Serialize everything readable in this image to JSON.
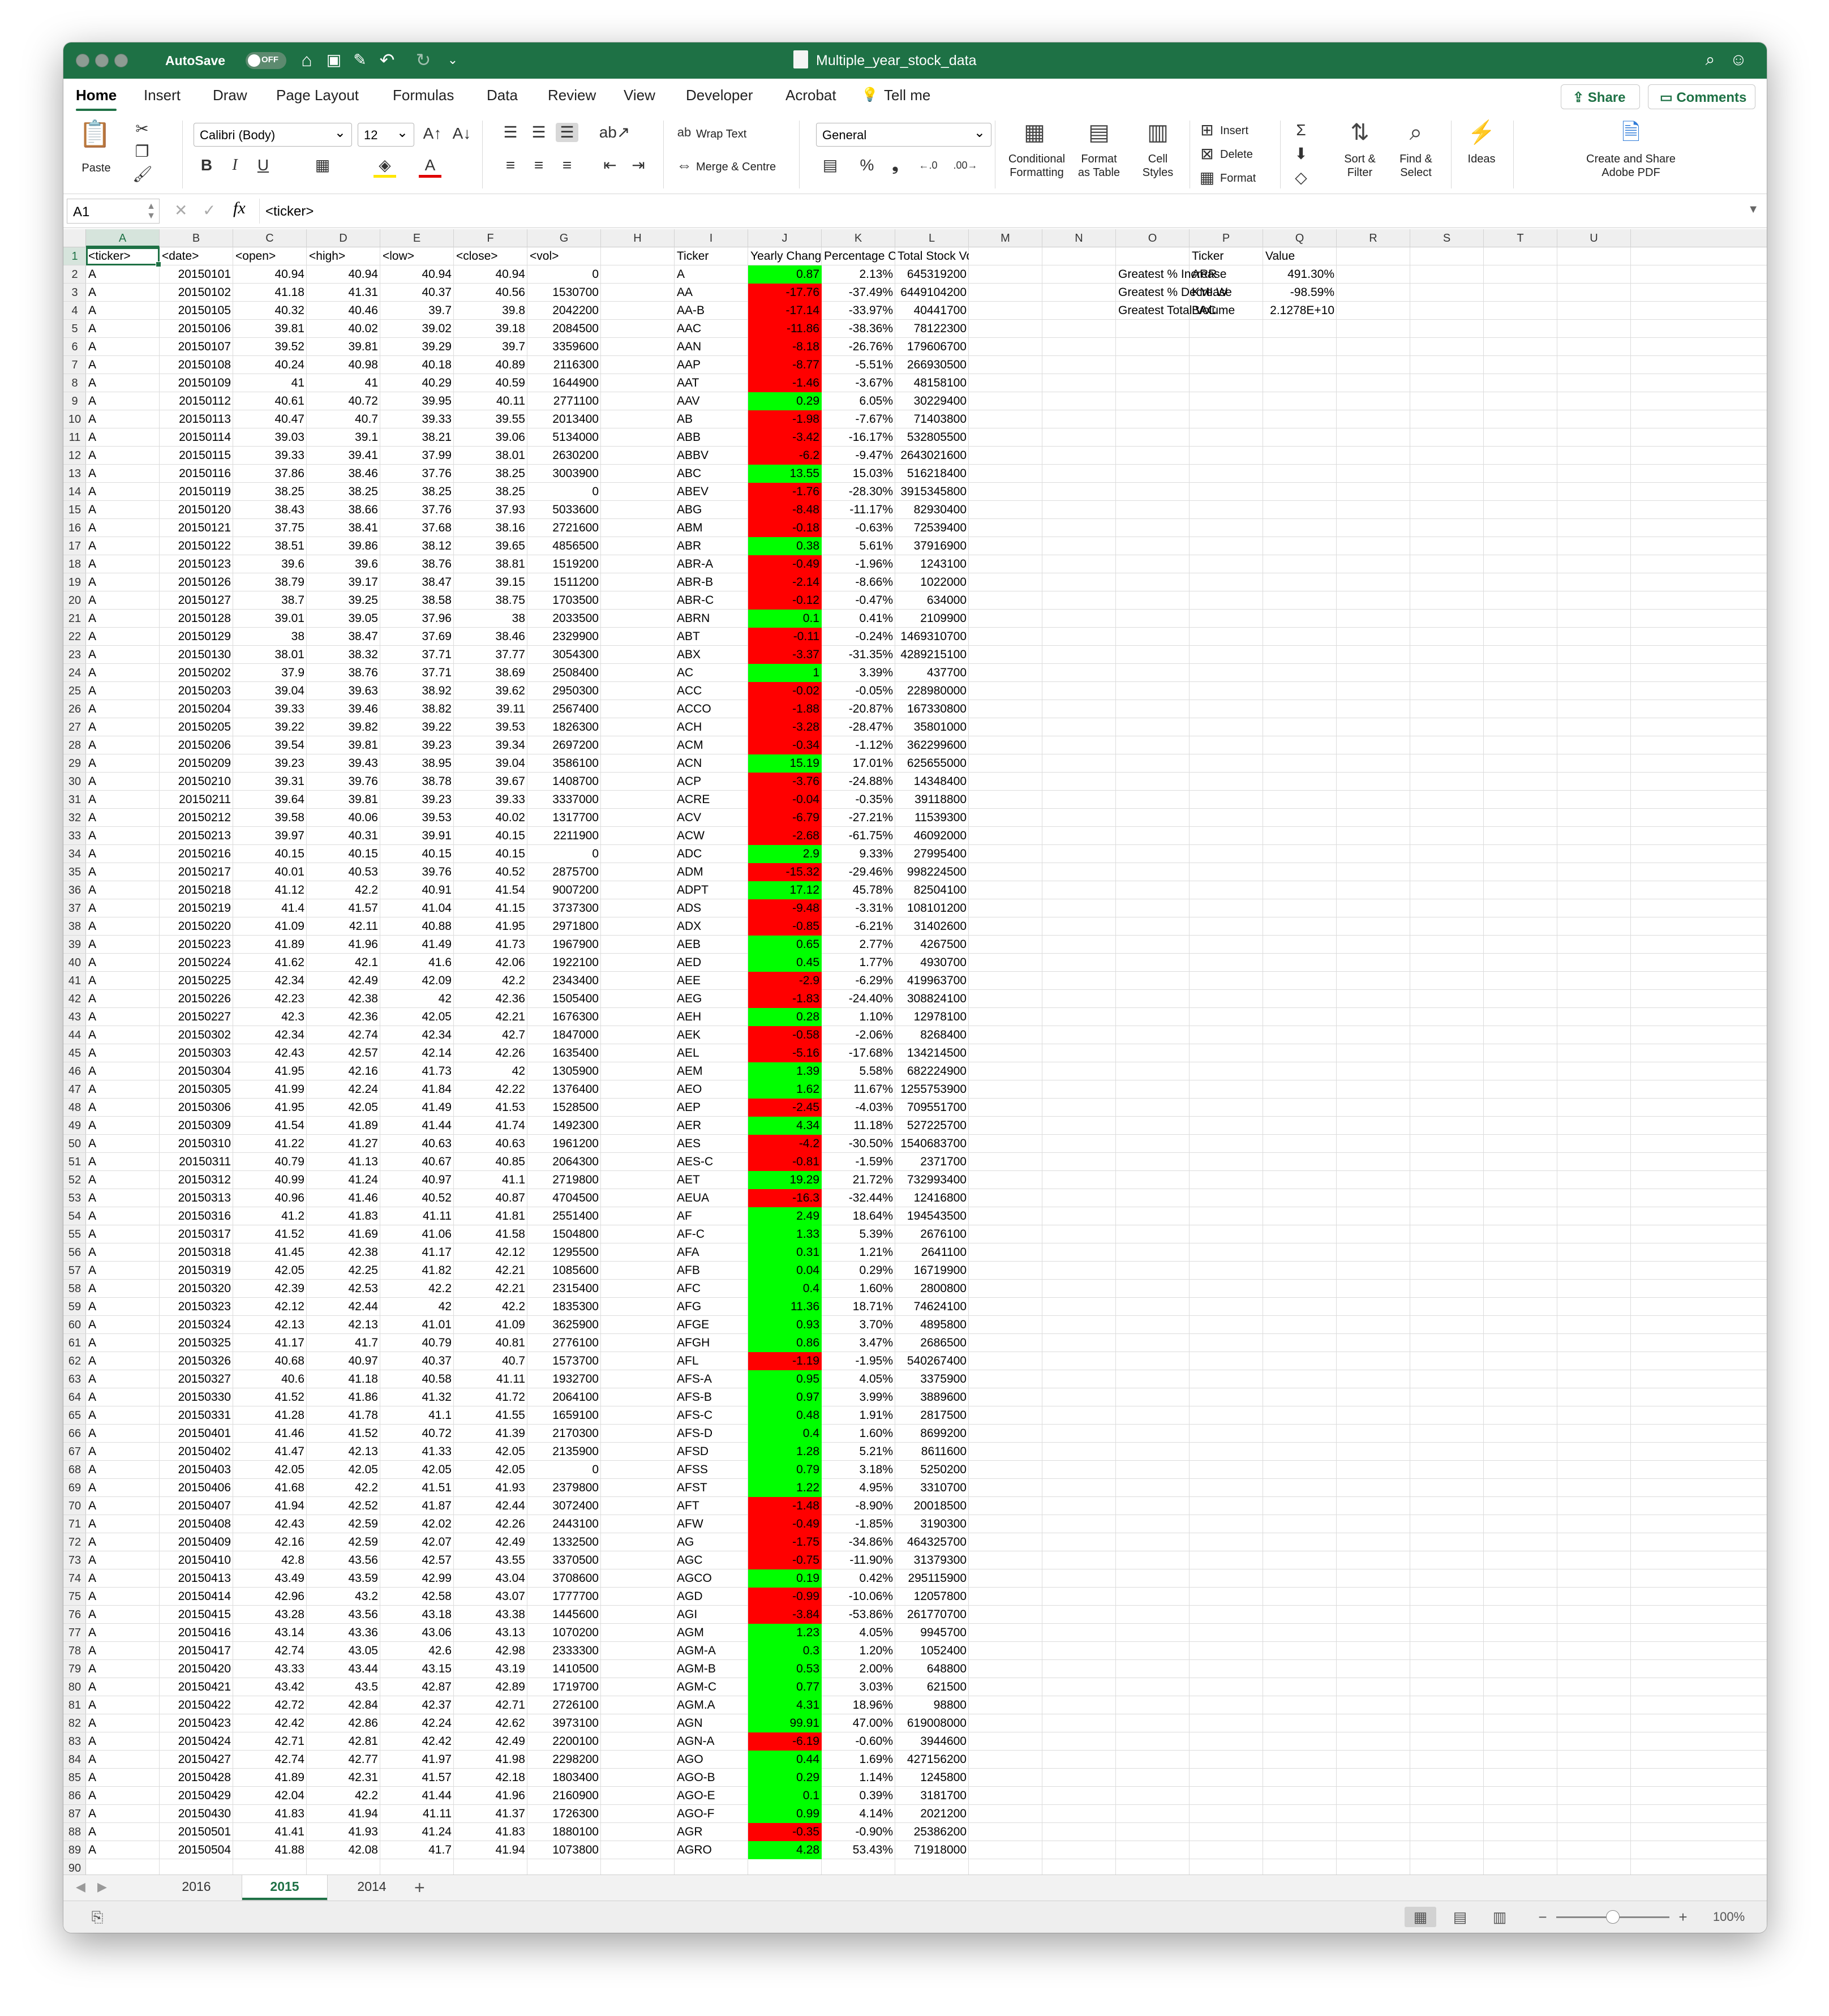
{
  "window": {
    "title": "Multiple_year_stock_data",
    "autosave_label": "AutoSave",
    "autosave_state": "OFF"
  },
  "ribbon_tabs": [
    "Home",
    "Insert",
    "Draw",
    "Page Layout",
    "Formulas",
    "Data",
    "Review",
    "View",
    "Developer",
    "Acrobat",
    "Tell me"
  ],
  "share_label": "Share",
  "comments_label": "Comments",
  "ribbon": {
    "paste": "Paste",
    "font_name": "Calibri (Body)",
    "font_size": "12",
    "bold": "B",
    "italic": "I",
    "underline": "U",
    "wrap_text": "Wrap Text",
    "merge_centre": "Merge & Centre",
    "number_format": "General",
    "conditional_formatting_1": "Conditional",
    "conditional_formatting_2": "Formatting",
    "format_table_1": "Format",
    "format_table_2": "as Table",
    "cell_styles_1": "Cell",
    "cell_styles_2": "Styles",
    "insert": "Insert",
    "delete": "Delete",
    "format": "Format",
    "sort_filter_1": "Sort &",
    "sort_filter_2": "Filter",
    "find_select_1": "Find &",
    "find_select_2": "Select",
    "ideas": "Ideas",
    "adobe_1": "Create and Share",
    "adobe_2": "Adobe PDF"
  },
  "formula_bar": {
    "name_box": "A1",
    "fx": "fx",
    "value": "<ticker>"
  },
  "columns": [
    "A",
    "B",
    "C",
    "D",
    "E",
    "F",
    "G",
    "H",
    "I",
    "J",
    "K",
    "L",
    "M",
    "N",
    "O",
    "P",
    "Q",
    "R",
    "S",
    "T",
    "U"
  ],
  "raw_headers": [
    "<ticker>",
    "<date>",
    "<open>",
    "<high>",
    "<low>",
    "<close>",
    "<vol>"
  ],
  "raw_rows": [
    [
      "A",
      "20150101",
      "40.94",
      "40.94",
      "40.94",
      "40.94",
      "0"
    ],
    [
      "A",
      "20150102",
      "41.18",
      "41.31",
      "40.37",
      "40.56",
      "1530700"
    ],
    [
      "A",
      "20150105",
      "40.32",
      "40.46",
      "39.7",
      "39.8",
      "2042200"
    ],
    [
      "A",
      "20150106",
      "39.81",
      "40.02",
      "39.02",
      "39.18",
      "2084500"
    ],
    [
      "A",
      "20150107",
      "39.52",
      "39.81",
      "39.29",
      "39.7",
      "3359600"
    ],
    [
      "A",
      "20150108",
      "40.24",
      "40.98",
      "40.18",
      "40.89",
      "2116300"
    ],
    [
      "A",
      "20150109",
      "41",
      "41",
      "40.29",
      "40.59",
      "1644900"
    ],
    [
      "A",
      "20150112",
      "40.61",
      "40.72",
      "39.95",
      "40.11",
      "2771100"
    ],
    [
      "A",
      "20150113",
      "40.47",
      "40.7",
      "39.33",
      "39.55",
      "2013400"
    ],
    [
      "A",
      "20150114",
      "39.03",
      "39.1",
      "38.21",
      "39.06",
      "5134000"
    ],
    [
      "A",
      "20150115",
      "39.33",
      "39.41",
      "37.99",
      "38.01",
      "2630200"
    ],
    [
      "A",
      "20150116",
      "37.86",
      "38.46",
      "37.76",
      "38.25",
      "3003900"
    ],
    [
      "A",
      "20150119",
      "38.25",
      "38.25",
      "38.25",
      "38.25",
      "0"
    ],
    [
      "A",
      "20150120",
      "38.43",
      "38.66",
      "37.76",
      "37.93",
      "5033600"
    ],
    [
      "A",
      "20150121",
      "37.75",
      "38.41",
      "37.68",
      "38.16",
      "2721600"
    ],
    [
      "A",
      "20150122",
      "38.51",
      "39.86",
      "38.12",
      "39.65",
      "4856500"
    ],
    [
      "A",
      "20150123",
      "39.6",
      "39.6",
      "38.76",
      "38.81",
      "1519200"
    ],
    [
      "A",
      "20150126",
      "38.79",
      "39.17",
      "38.47",
      "39.15",
      "1511200"
    ],
    [
      "A",
      "20150127",
      "38.7",
      "39.25",
      "38.58",
      "38.75",
      "1703500"
    ],
    [
      "A",
      "20150128",
      "39.01",
      "39.05",
      "37.96",
      "38",
      "2033500"
    ],
    [
      "A",
      "20150129",
      "38",
      "38.47",
      "37.69",
      "38.46",
      "2329900"
    ],
    [
      "A",
      "20150130",
      "38.01",
      "38.32",
      "37.71",
      "37.77",
      "3054300"
    ],
    [
      "A",
      "20150202",
      "37.9",
      "38.76",
      "37.71",
      "38.69",
      "2508400"
    ],
    [
      "A",
      "20150203",
      "39.04",
      "39.63",
      "38.92",
      "39.62",
      "2950300"
    ],
    [
      "A",
      "20150204",
      "39.33",
      "39.46",
      "38.82",
      "39.11",
      "2567400"
    ],
    [
      "A",
      "20150205",
      "39.22",
      "39.82",
      "39.22",
      "39.53",
      "1826300"
    ],
    [
      "A",
      "20150206",
      "39.54",
      "39.81",
      "39.23",
      "39.34",
      "2697200"
    ],
    [
      "A",
      "20150209",
      "39.23",
      "39.43",
      "38.95",
      "39.04",
      "3586100"
    ],
    [
      "A",
      "20150210",
      "39.31",
      "39.76",
      "38.78",
      "39.67",
      "1408700"
    ],
    [
      "A",
      "20150211",
      "39.64",
      "39.81",
      "39.23",
      "39.33",
      "3337000"
    ],
    [
      "A",
      "20150212",
      "39.58",
      "40.06",
      "39.53",
      "40.02",
      "1317700"
    ],
    [
      "A",
      "20150213",
      "39.97",
      "40.31",
      "39.91",
      "40.15",
      "2211900"
    ],
    [
      "A",
      "20150216",
      "40.15",
      "40.15",
      "40.15",
      "40.15",
      "0"
    ],
    [
      "A",
      "20150217",
      "40.01",
      "40.53",
      "39.76",
      "40.52",
      "2875700"
    ],
    [
      "A",
      "20150218",
      "41.12",
      "42.2",
      "40.91",
      "41.54",
      "9007200"
    ],
    [
      "A",
      "20150219",
      "41.4",
      "41.57",
      "41.04",
      "41.15",
      "3737300"
    ],
    [
      "A",
      "20150220",
      "41.09",
      "42.11",
      "40.88",
      "41.95",
      "2971800"
    ],
    [
      "A",
      "20150223",
      "41.89",
      "41.96",
      "41.49",
      "41.73",
      "1967900"
    ],
    [
      "A",
      "20150224",
      "41.62",
      "42.1",
      "41.6",
      "42.06",
      "1922100"
    ],
    [
      "A",
      "20150225",
      "42.34",
      "42.49",
      "42.09",
      "42.2",
      "2343400"
    ],
    [
      "A",
      "20150226",
      "42.23",
      "42.38",
      "42",
      "42.36",
      "1505400"
    ],
    [
      "A",
      "20150227",
      "42.3",
      "42.36",
      "42.05",
      "42.21",
      "1676300"
    ],
    [
      "A",
      "20150302",
      "42.34",
      "42.74",
      "42.34",
      "42.7",
      "1847000"
    ],
    [
      "A",
      "20150303",
      "42.43",
      "42.57",
      "42.14",
      "42.26",
      "1635400"
    ],
    [
      "A",
      "20150304",
      "41.95",
      "42.16",
      "41.73",
      "42",
      "1305900"
    ],
    [
      "A",
      "20150305",
      "41.99",
      "42.24",
      "41.84",
      "42.22",
      "1376400"
    ],
    [
      "A",
      "20150306",
      "41.95",
      "42.05",
      "41.49",
      "41.53",
      "1528500"
    ],
    [
      "A",
      "20150309",
      "41.54",
      "41.89",
      "41.44",
      "41.74",
      "1492300"
    ],
    [
      "A",
      "20150310",
      "41.22",
      "41.27",
      "40.63",
      "40.63",
      "1961200"
    ],
    [
      "A",
      "20150311",
      "40.79",
      "41.13",
      "40.67",
      "40.85",
      "2064300"
    ],
    [
      "A",
      "20150312",
      "40.99",
      "41.24",
      "40.97",
      "41.1",
      "2719800"
    ],
    [
      "A",
      "20150313",
      "40.96",
      "41.46",
      "40.52",
      "40.87",
      "4704500"
    ],
    [
      "A",
      "20150316",
      "41.2",
      "41.83",
      "41.11",
      "41.81",
      "2551400"
    ],
    [
      "A",
      "20150317",
      "41.52",
      "41.69",
      "41.06",
      "41.58",
      "1504800"
    ],
    [
      "A",
      "20150318",
      "41.45",
      "42.38",
      "41.17",
      "42.12",
      "1295500"
    ],
    [
      "A",
      "20150319",
      "42.05",
      "42.25",
      "41.82",
      "42.21",
      "1085600"
    ],
    [
      "A",
      "20150320",
      "42.39",
      "42.53",
      "42.2",
      "42.21",
      "2315400"
    ],
    [
      "A",
      "20150323",
      "42.12",
      "42.44",
      "42",
      "42.2",
      "1835300"
    ],
    [
      "A",
      "20150324",
      "42.13",
      "42.13",
      "41.01",
      "41.09",
      "3625900"
    ],
    [
      "A",
      "20150325",
      "41.17",
      "41.7",
      "40.79",
      "40.81",
      "2776100"
    ],
    [
      "A",
      "20150326",
      "40.68",
      "40.97",
      "40.37",
      "40.7",
      "1573700"
    ],
    [
      "A",
      "20150327",
      "40.6",
      "41.18",
      "40.58",
      "41.11",
      "1932700"
    ],
    [
      "A",
      "20150330",
      "41.52",
      "41.86",
      "41.32",
      "41.72",
      "2064100"
    ],
    [
      "A",
      "20150331",
      "41.28",
      "41.78",
      "41.1",
      "41.55",
      "1659100"
    ],
    [
      "A",
      "20150401",
      "41.46",
      "41.52",
      "40.72",
      "41.39",
      "2170300"
    ],
    [
      "A",
      "20150402",
      "41.47",
      "42.13",
      "41.33",
      "42.05",
      "2135900"
    ],
    [
      "A",
      "20150403",
      "42.05",
      "42.05",
      "42.05",
      "42.05",
      "0"
    ],
    [
      "A",
      "20150406",
      "41.68",
      "42.2",
      "41.51",
      "41.93",
      "2379800"
    ],
    [
      "A",
      "20150407",
      "41.94",
      "42.52",
      "41.87",
      "42.44",
      "3072400"
    ],
    [
      "A",
      "20150408",
      "42.43",
      "42.59",
      "42.02",
      "42.26",
      "2443100"
    ],
    [
      "A",
      "20150409",
      "42.16",
      "42.59",
      "42.07",
      "42.49",
      "1332500"
    ],
    [
      "A",
      "20150410",
      "42.8",
      "43.56",
      "42.57",
      "43.55",
      "3370500"
    ],
    [
      "A",
      "20150413",
      "43.49",
      "43.59",
      "42.99",
      "43.04",
      "3708600"
    ],
    [
      "A",
      "20150414",
      "42.96",
      "43.2",
      "42.58",
      "43.07",
      "1777700"
    ],
    [
      "A",
      "20150415",
      "43.28",
      "43.56",
      "43.18",
      "43.38",
      "1445600"
    ],
    [
      "A",
      "20150416",
      "43.14",
      "43.36",
      "43.06",
      "43.13",
      "1070200"
    ],
    [
      "A",
      "20150417",
      "42.74",
      "43.05",
      "42.6",
      "42.98",
      "2333300"
    ],
    [
      "A",
      "20150420",
      "43.33",
      "43.44",
      "43.15",
      "43.19",
      "1410500"
    ],
    [
      "A",
      "20150421",
      "43.42",
      "43.5",
      "42.87",
      "42.89",
      "1719700"
    ],
    [
      "A",
      "20150422",
      "42.72",
      "42.84",
      "42.37",
      "42.71",
      "2726100"
    ],
    [
      "A",
      "20150423",
      "42.42",
      "42.86",
      "42.24",
      "42.62",
      "3973100"
    ],
    [
      "A",
      "20150424",
      "42.71",
      "42.81",
      "42.42",
      "42.49",
      "2200100"
    ],
    [
      "A",
      "20150427",
      "42.74",
      "42.77",
      "41.97",
      "41.98",
      "2298200"
    ],
    [
      "A",
      "20150428",
      "41.89",
      "42.31",
      "41.57",
      "42.18",
      "1803400"
    ],
    [
      "A",
      "20150429",
      "42.04",
      "42.2",
      "41.44",
      "41.96",
      "2160900"
    ],
    [
      "A",
      "20150430",
      "41.83",
      "41.94",
      "41.11",
      "41.37",
      "1726300"
    ],
    [
      "A",
      "20150501",
      "41.41",
      "41.93",
      "41.24",
      "41.83",
      "1880100"
    ],
    [
      "A",
      "20150504",
      "41.88",
      "42.08",
      "41.7",
      "41.94",
      "1073800"
    ]
  ],
  "summary_headers": [
    "Ticker",
    "Yearly Change",
    "Percentage Change",
    "Total Stock Volumne"
  ],
  "summary_rows": [
    [
      "A",
      "0.87",
      "2.13%",
      "645319200"
    ],
    [
      "AA",
      "-17.76",
      "-37.49%",
      "6449104200"
    ],
    [
      "AA-B",
      "-17.14",
      "-33.97%",
      "40441700"
    ],
    [
      "AAC",
      "-11.86",
      "-38.36%",
      "78122300"
    ],
    [
      "AAN",
      "-8.18",
      "-26.76%",
      "179606700"
    ],
    [
      "AAP",
      "-8.77",
      "-5.51%",
      "266930500"
    ],
    [
      "AAT",
      "-1.46",
      "-3.67%",
      "48158100"
    ],
    [
      "AAV",
      "0.29",
      "6.05%",
      "30229400"
    ],
    [
      "AB",
      "-1.98",
      "-7.67%",
      "71403800"
    ],
    [
      "ABB",
      "-3.42",
      "-16.17%",
      "532805500"
    ],
    [
      "ABBV",
      "-6.2",
      "-9.47%",
      "2643021600"
    ],
    [
      "ABC",
      "13.55",
      "15.03%",
      "516218400"
    ],
    [
      "ABEV",
      "-1.76",
      "-28.30%",
      "3915345800"
    ],
    [
      "ABG",
      "-8.48",
      "-11.17%",
      "82930400"
    ],
    [
      "ABM",
      "-0.18",
      "-0.63%",
      "72539400"
    ],
    [
      "ABR",
      "0.38",
      "5.61%",
      "37916900"
    ],
    [
      "ABR-A",
      "-0.49",
      "-1.96%",
      "1243100"
    ],
    [
      "ABR-B",
      "-2.14",
      "-8.66%",
      "1022000"
    ],
    [
      "ABR-C",
      "-0.12",
      "-0.47%",
      "634000"
    ],
    [
      "ABRN",
      "0.1",
      "0.41%",
      "2109900"
    ],
    [
      "ABT",
      "-0.11",
      "-0.24%",
      "1469310700"
    ],
    [
      "ABX",
      "-3.37",
      "-31.35%",
      "4289215100"
    ],
    [
      "AC",
      "1",
      "3.39%",
      "437700"
    ],
    [
      "ACC",
      "-0.02",
      "-0.05%",
      "228980000"
    ],
    [
      "ACCO",
      "-1.88",
      "-20.87%",
      "167330800"
    ],
    [
      "ACH",
      "-3.28",
      "-28.47%",
      "35801000"
    ],
    [
      "ACM",
      "-0.34",
      "-1.12%",
      "362299600"
    ],
    [
      "ACN",
      "15.19",
      "17.01%",
      "625655000"
    ],
    [
      "ACP",
      "-3.76",
      "-24.88%",
      "14348400"
    ],
    [
      "ACRE",
      "-0.04",
      "-0.35%",
      "39118800"
    ],
    [
      "ACV",
      "-6.79",
      "-27.21%",
      "11539300"
    ],
    [
      "ACW",
      "-2.68",
      "-61.75%",
      "46092000"
    ],
    [
      "ADC",
      "2.9",
      "9.33%",
      "27995400"
    ],
    [
      "ADM",
      "-15.32",
      "-29.46%",
      "998224500"
    ],
    [
      "ADPT",
      "17.12",
      "45.78%",
      "82504100"
    ],
    [
      "ADS",
      "-9.48",
      "-3.31%",
      "108101200"
    ],
    [
      "ADX",
      "-0.85",
      "-6.21%",
      "31402600"
    ],
    [
      "AEB",
      "0.65",
      "2.77%",
      "4267500"
    ],
    [
      "AED",
      "0.45",
      "1.77%",
      "4930700"
    ],
    [
      "AEE",
      "-2.9",
      "-6.29%",
      "419963700"
    ],
    [
      "AEG",
      "-1.83",
      "-24.40%",
      "308824100"
    ],
    [
      "AEH",
      "0.28",
      "1.10%",
      "12978100"
    ],
    [
      "AEK",
      "-0.58",
      "-2.06%",
      "8268400"
    ],
    [
      "AEL",
      "-5.16",
      "-17.68%",
      "134214500"
    ],
    [
      "AEM",
      "1.39",
      "5.58%",
      "682224900"
    ],
    [
      "AEO",
      "1.62",
      "11.67%",
      "1255753900"
    ],
    [
      "AEP",
      "-2.45",
      "-4.03%",
      "709551700"
    ],
    [
      "AER",
      "4.34",
      "11.18%",
      "527225700"
    ],
    [
      "AES",
      "-4.2",
      "-30.50%",
      "1540683700"
    ],
    [
      "AES-C",
      "-0.81",
      "-1.59%",
      "2371700"
    ],
    [
      "AET",
      "19.29",
      "21.72%",
      "732993400"
    ],
    [
      "AEUA",
      "-16.3",
      "-32.44%",
      "12416800"
    ],
    [
      "AF",
      "2.49",
      "18.64%",
      "194543500"
    ],
    [
      "AF-C",
      "1.33",
      "5.39%",
      "2676100"
    ],
    [
      "AFA",
      "0.31",
      "1.21%",
      "2641100"
    ],
    [
      "AFB",
      "0.04",
      "0.29%",
      "16719900"
    ],
    [
      "AFC",
      "0.4",
      "1.60%",
      "2800800"
    ],
    [
      "AFG",
      "11.36",
      "18.71%",
      "74624100"
    ],
    [
      "AFGE",
      "0.93",
      "3.70%",
      "4895800"
    ],
    [
      "AFGH",
      "0.86",
      "3.47%",
      "2686500"
    ],
    [
      "AFL",
      "-1.19",
      "-1.95%",
      "540267400"
    ],
    [
      "AFS-A",
      "0.95",
      "4.05%",
      "3375900"
    ],
    [
      "AFS-B",
      "0.97",
      "3.99%",
      "3889600"
    ],
    [
      "AFS-C",
      "0.48",
      "1.91%",
      "2817500"
    ],
    [
      "AFS-D",
      "0.4",
      "1.60%",
      "8699200"
    ],
    [
      "AFSD",
      "1.28",
      "5.21%",
      "8611600"
    ],
    [
      "AFSS",
      "0.79",
      "3.18%",
      "5250200"
    ],
    [
      "AFST",
      "1.22",
      "4.95%",
      "3310700"
    ],
    [
      "AFT",
      "-1.48",
      "-8.90%",
      "20018500"
    ],
    [
      "AFW",
      "-0.49",
      "-1.85%",
      "3190300"
    ],
    [
      "AG",
      "-1.75",
      "-34.86%",
      "464325700"
    ],
    [
      "AGC",
      "-0.75",
      "-11.90%",
      "31379300"
    ],
    [
      "AGCO",
      "0.19",
      "0.42%",
      "295115900"
    ],
    [
      "AGD",
      "-0.99",
      "-10.06%",
      "12057800"
    ],
    [
      "AGI",
      "-3.84",
      "-53.86%",
      "261770700"
    ],
    [
      "AGM",
      "1.23",
      "4.05%",
      "9945700"
    ],
    [
      "AGM-A",
      "0.3",
      "1.20%",
      "1052400"
    ],
    [
      "AGM-B",
      "0.53",
      "2.00%",
      "648800"
    ],
    [
      "AGM-C",
      "0.77",
      "3.03%",
      "621500"
    ],
    [
      "AGM.A",
      "4.31",
      "18.96%",
      "98800"
    ],
    [
      "AGN",
      "99.91",
      "47.00%",
      "619008000"
    ],
    [
      "AGN-A",
      "-6.19",
      "-0.60%",
      "3944600"
    ],
    [
      "AGO",
      "0.44",
      "1.69%",
      "427156200"
    ],
    [
      "AGO-B",
      "0.29",
      "1.14%",
      "1245800"
    ],
    [
      "AGO-E",
      "0.1",
      "0.39%",
      "3181700"
    ],
    [
      "AGO-F",
      "0.99",
      "4.14%",
      "2021200"
    ],
    [
      "AGR",
      "-0.35",
      "-0.90%",
      "25386200"
    ],
    [
      "AGRO",
      "4.28",
      "53.43%",
      "71918000"
    ]
  ],
  "greatest": {
    "headers": [
      "Ticker",
      "Value"
    ],
    "rows": [
      [
        "Greatest % Increase",
        "ARR",
        "491.30%"
      ],
      [
        "Greatest % Decrease",
        "KMI.W",
        "-98.59%"
      ],
      [
        "Greatest Total Volume",
        "BAC",
        "2.1278E+10"
      ]
    ]
  },
  "sheets": [
    "2016",
    "2015",
    "2014"
  ],
  "active_sheet": "2015",
  "zoom": "100%",
  "colors": {
    "accent": "#1e7145",
    "positive": "#00ff00",
    "negative": "#ff0000"
  }
}
